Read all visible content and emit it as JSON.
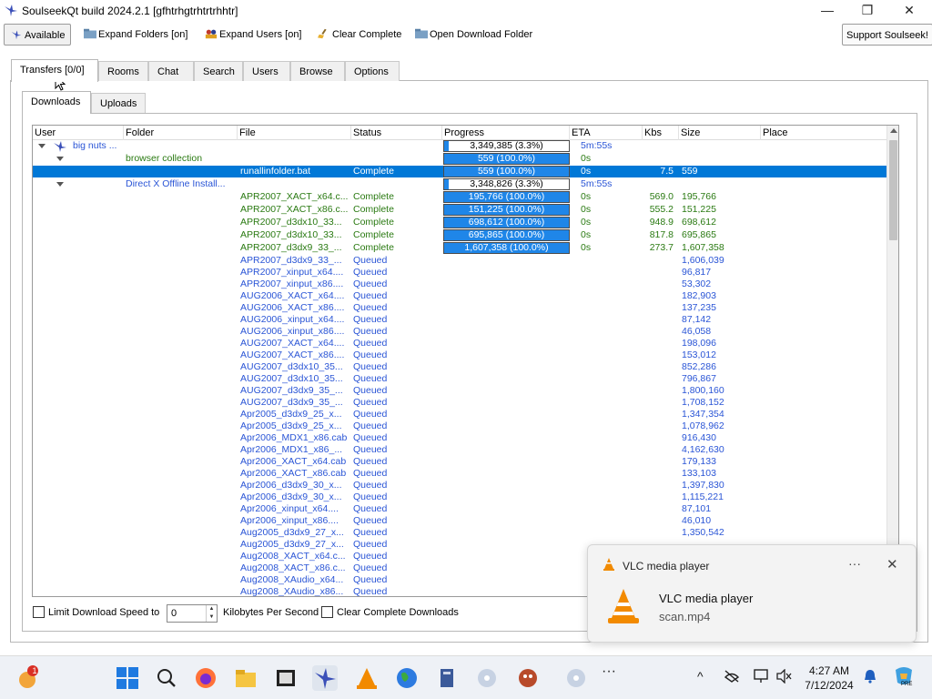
{
  "window": {
    "title": "SoulseekQt build 2024.2.1 [gfhtrhgtrhtrtrhhtr]",
    "controls": {
      "minimize": "—",
      "maximize": "❐",
      "close": "✕"
    }
  },
  "toolbar": {
    "available": "Available",
    "expand_folders": "Expand Folders [on]",
    "expand_users": "Expand Users [on]",
    "clear_complete": "Clear Complete",
    "open_download_folder": "Open Download Folder",
    "support": "Support Soulseek!"
  },
  "tabs": [
    "Transfers [0/0]",
    "Rooms",
    "Chat",
    "Search",
    "Users",
    "Browse",
    "Options"
  ],
  "subtabs": [
    "Downloads",
    "Uploads"
  ],
  "columns": [
    "User",
    "Folder",
    "File",
    "Status",
    "Progress",
    "ETA",
    "Kbs",
    "Size",
    "Place"
  ],
  "groups": {
    "user": {
      "name": "big nuts ...",
      "progress": "3,349,385 (3.3%)",
      "eta": "5m:55s"
    },
    "folder1": {
      "name": "browser collection",
      "progress": "559 (100.0%)",
      "eta": "0s"
    },
    "folder2": {
      "name": "Direct X Offline Install...",
      "progress": "3,348,826 (3.3%)",
      "eta": "5m:55s"
    }
  },
  "files": [
    {
      "file": "runallinfolder.bat",
      "status": "Complete",
      "progress": "559 (100.0%)",
      "eta": "0s",
      "kbs": "7.5",
      "size": "559"
    },
    {
      "file": "APR2007_XACT_x64.c...",
      "status": "Complete",
      "progress": "195,766 (100.0%)",
      "eta": "0s",
      "kbs": "569.0",
      "size": "195,766"
    },
    {
      "file": "APR2007_XACT_x86.c...",
      "status": "Complete",
      "progress": "151,225 (100.0%)",
      "eta": "0s",
      "kbs": "555.2",
      "size": "151,225"
    },
    {
      "file": "APR2007_d3dx10_33...",
      "status": "Complete",
      "progress": "698,612 (100.0%)",
      "eta": "0s",
      "kbs": "948.9",
      "size": "698,612"
    },
    {
      "file": "APR2007_d3dx10_33...",
      "status": "Complete",
      "progress": "695,865 (100.0%)",
      "eta": "0s",
      "kbs": "817.8",
      "size": "695,865"
    },
    {
      "file": "APR2007_d3dx9_33_...",
      "status": "Complete",
      "progress": "1,607,358 (100.0%)",
      "eta": "0s",
      "kbs": "273.7",
      "size": "1,607,358"
    },
    {
      "file": "APR2007_d3dx9_33_...",
      "status": "Queued",
      "size": "1,606,039"
    },
    {
      "file": "APR2007_xinput_x64....",
      "status": "Queued",
      "size": "96,817"
    },
    {
      "file": "APR2007_xinput_x86....",
      "status": "Queued",
      "size": "53,302"
    },
    {
      "file": "AUG2006_XACT_x64....",
      "status": "Queued",
      "size": "182,903"
    },
    {
      "file": "AUG2006_XACT_x86....",
      "status": "Queued",
      "size": "137,235"
    },
    {
      "file": "AUG2006_xinput_x64....",
      "status": "Queued",
      "size": "87,142"
    },
    {
      "file": "AUG2006_xinput_x86....",
      "status": "Queued",
      "size": "46,058"
    },
    {
      "file": "AUG2007_XACT_x64....",
      "status": "Queued",
      "size": "198,096"
    },
    {
      "file": "AUG2007_XACT_x86....",
      "status": "Queued",
      "size": "153,012"
    },
    {
      "file": "AUG2007_d3dx10_35...",
      "status": "Queued",
      "size": "852,286"
    },
    {
      "file": "AUG2007_d3dx10_35...",
      "status": "Queued",
      "size": "796,867"
    },
    {
      "file": "AUG2007_d3dx9_35_...",
      "status": "Queued",
      "size": "1,800,160"
    },
    {
      "file": "AUG2007_d3dx9_35_...",
      "status": "Queued",
      "size": "1,708,152"
    },
    {
      "file": "Apr2005_d3dx9_25_x...",
      "status": "Queued",
      "size": "1,347,354"
    },
    {
      "file": "Apr2005_d3dx9_25_x...",
      "status": "Queued",
      "size": "1,078,962"
    },
    {
      "file": "Apr2006_MDX1_x86.cab",
      "status": "Queued",
      "size": "916,430"
    },
    {
      "file": "Apr2006_MDX1_x86_...",
      "status": "Queued",
      "size": "4,162,630"
    },
    {
      "file": "Apr2006_XACT_x64.cab",
      "status": "Queued",
      "size": "179,133"
    },
    {
      "file": "Apr2006_XACT_x86.cab",
      "status": "Queued",
      "size": "133,103"
    },
    {
      "file": "Apr2006_d3dx9_30_x...",
      "status": "Queued",
      "size": "1,397,830"
    },
    {
      "file": "Apr2006_d3dx9_30_x...",
      "status": "Queued",
      "size": "1,115,221"
    },
    {
      "file": "Apr2006_xinput_x64....",
      "status": "Queued",
      "size": "87,101"
    },
    {
      "file": "Apr2006_xinput_x86....",
      "status": "Queued",
      "size": "46,010"
    },
    {
      "file": "Aug2005_d3dx9_27_x...",
      "status": "Queued",
      "size": "1,350,542"
    },
    {
      "file": "Aug2005_d3dx9_27_x...",
      "status": "Queued",
      "size": ""
    },
    {
      "file": "Aug2008_XACT_x64.c...",
      "status": "Queued",
      "size": ""
    },
    {
      "file": "Aug2008_XACT_x86.c...",
      "status": "Queued",
      "size": ""
    },
    {
      "file": "Aug2008_XAudio_x64...",
      "status": "Queued",
      "size": ""
    },
    {
      "file": "Aug2008_XAudio_x86...",
      "status": "Queued",
      "size": ""
    }
  ],
  "bottom": {
    "limit_label": "Limit Download Speed to",
    "speed_value": "0",
    "kbps_label": "Kilobytes Per Second",
    "clear_label": "Clear Complete Downloads"
  },
  "toast": {
    "app": "VLC media player",
    "title": "VLC media player",
    "body": "scan.mp4",
    "more": "···",
    "close": "✕"
  },
  "taskbar": {
    "badge": "1",
    "time": "4:27 AM",
    "date": "7/12/2024",
    "overflow": "···",
    "tray_chevron": "^",
    "colors": {
      "accent": "#0078d7"
    }
  }
}
